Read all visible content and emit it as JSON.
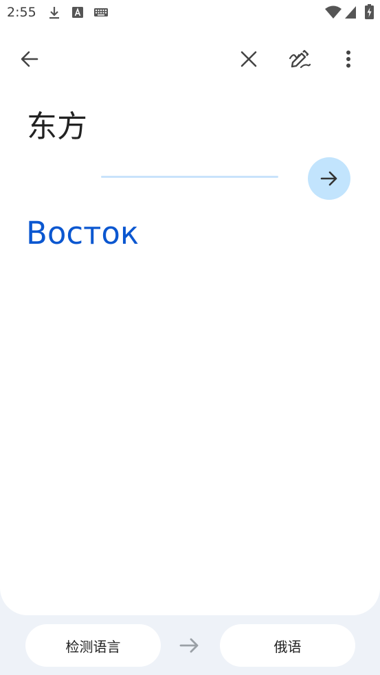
{
  "status_bar": {
    "time": "2:55",
    "icons": [
      "download-icon",
      "font-a-icon",
      "keyboard-icon",
      "wifi-icon",
      "signal-icon",
      "battery-charging-icon"
    ]
  },
  "toolbar": {
    "icons": [
      "back-arrow-icon",
      "close-icon",
      "handwriting-icon",
      "more-vert-icon"
    ]
  },
  "input": {
    "text": "东方"
  },
  "translate_button": {
    "icon": "arrow-right-icon",
    "color": "#c2e4fd"
  },
  "result": {
    "text": "Восток",
    "color": "#0b57d0"
  },
  "language_bar": {
    "source_language": "检测语言",
    "target_language": "俄语",
    "swap_icon": "arrow-right-icon"
  }
}
